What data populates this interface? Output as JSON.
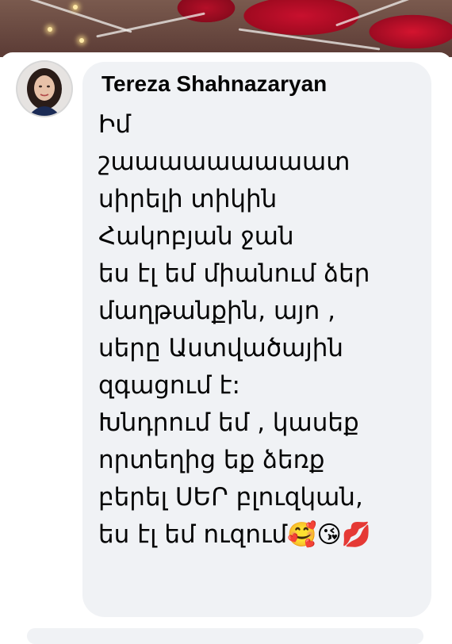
{
  "comment": {
    "author": "Tereza Shahnazaryan",
    "lines": [
      "Իմ",
      "շաաաաաաաաատ",
      "սիրելի տիկին",
      "Հակոբյան ջան",
      "ես էլ եմ միանում ձեր",
      "մաղթանքին, այո ,",
      "սերը Աստվածային",
      "զգացում է:",
      "Խնդրում եմ , կասեք",
      "որտեղից եք ձեռք",
      "բերել ՍԵՐ բլուզկան,",
      "ես էլ եմ ուզում"
    ],
    "trailing_emojis": "🥰😘💋"
  },
  "colors": {
    "bubble_bg": "#f0f2f5",
    "text": "#050505",
    "accent_red": "#c8102e"
  }
}
